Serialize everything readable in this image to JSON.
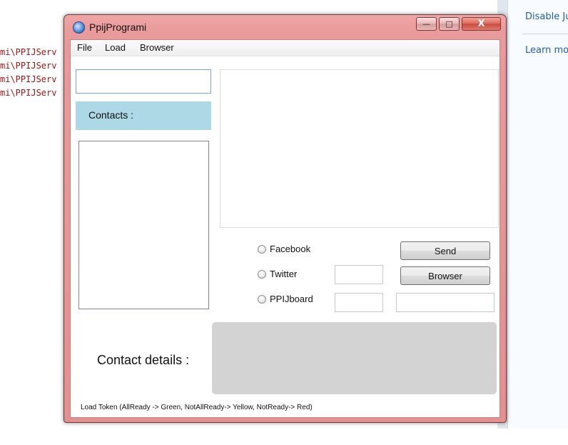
{
  "background": {
    "code_lines": [
      "mi\\PPIJServ",
      "mi\\PPIJServ",
      "mi\\PPIJServ",
      "mi\\PPIJServ"
    ],
    "right_links": [
      "Disable Ju",
      "Learn mo"
    ]
  },
  "window": {
    "title": "PpijProgrami",
    "controls": {
      "minimize": "—",
      "maximize": "□",
      "close": "X"
    }
  },
  "menu": [
    "File",
    "Load",
    "Browser"
  ],
  "contacts": {
    "header": "Contacts :"
  },
  "platforms": [
    "Facebook",
    "Twitter",
    "PPIJboard"
  ],
  "buttons": {
    "send": "Send",
    "browser": "Browser"
  },
  "details": {
    "label": "Contact details :"
  },
  "status": "Load Token (AllReady -> Green, NotAllReady-> Yellow, NotReady-> Red)",
  "colors": {
    "contacts_header": "#add8e6",
    "details_panel": "#d3d3d3",
    "title_bar": "#e58f8f"
  }
}
